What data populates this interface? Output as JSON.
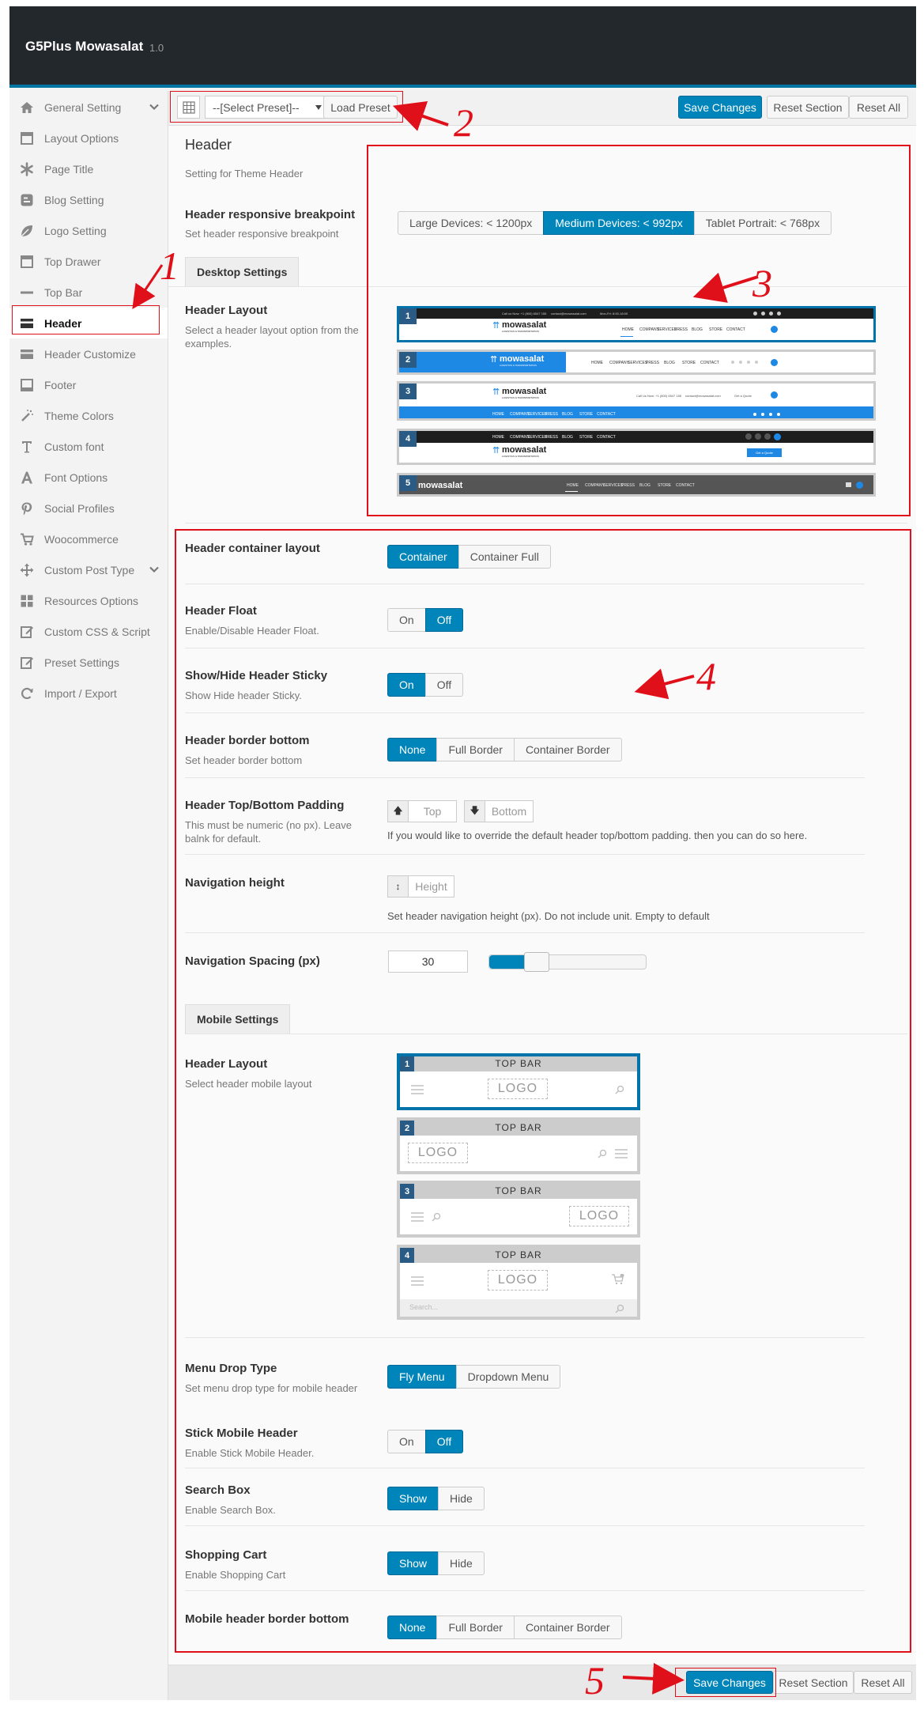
{
  "app": {
    "title": "G5Plus Mowasalat",
    "version": "1.0"
  },
  "sidebar": {
    "items": [
      {
        "label": "General Setting",
        "icon": "home-icon",
        "expandable": true
      },
      {
        "label": "Layout Options",
        "icon": "layout-icon"
      },
      {
        "label": "Page Title",
        "icon": "asterisk-icon"
      },
      {
        "label": "Blog Setting",
        "icon": "blogger-icon"
      },
      {
        "label": "Logo Setting",
        "icon": "leaf-icon"
      },
      {
        "label": "Top Drawer",
        "icon": "window-icon"
      },
      {
        "label": "Top Bar",
        "icon": "minus-icon"
      },
      {
        "label": "Header",
        "icon": "card-icon",
        "active": true
      },
      {
        "label": "Header Customize",
        "icon": "header-bars-icon"
      },
      {
        "label": "Footer",
        "icon": "footer-icon"
      },
      {
        "label": "Theme Colors",
        "icon": "magic-wand-icon"
      },
      {
        "label": "Custom font",
        "icon": "text-icon"
      },
      {
        "label": "Font Options",
        "icon": "font-icon"
      },
      {
        "label": "Social Profiles",
        "icon": "pinterest-icon"
      },
      {
        "label": "Woocommerce",
        "icon": "cart-icon"
      },
      {
        "label": "Custom Post Type",
        "icon": "move-icon",
        "expandable": true
      },
      {
        "label": "Resources Options",
        "icon": "grid-icon"
      },
      {
        "label": "Custom CSS & Script",
        "icon": "edit-icon"
      },
      {
        "label": "Preset Settings",
        "icon": "edit-icon"
      },
      {
        "label": "Import / Export",
        "icon": "refresh-icon"
      }
    ]
  },
  "toolbar": {
    "preset_placeholder": "--[Select Preset]--",
    "load_preset": "Load Preset",
    "save_changes": "Save Changes",
    "reset_section": "Reset Section",
    "reset_all": "Reset All"
  },
  "section": {
    "title": "Header",
    "subtitle": "Setting for Theme Header"
  },
  "breakpoint": {
    "title": "Header responsive breakpoint",
    "desc": "Set header responsive breakpoint",
    "options": [
      "Large Devices: < 1200px",
      "Medium Devices: < 992px",
      "Tablet Portrait: < 768px"
    ],
    "selected": 1
  },
  "desktop": {
    "tab": "Desktop Settings",
    "layout_title": "Header Layout",
    "layout_desc": [
      "Select a header layout option from the",
      "examples."
    ],
    "layouts": [
      {
        "num": "1",
        "logo": "mowasalat",
        "tagline": "LOGISTICS & TRANSPORTATION",
        "nav": [
          "HOME",
          "COMPANY",
          "SERVICES",
          "PRESS",
          "BLOG",
          "STORE",
          "CONTACT"
        ],
        "topbar_text": [
          "Call us Now: +1 (800) 6547 155",
          "contact@mowasalat.com",
          "Mon-Fri: 8:00-18:00"
        ]
      },
      {
        "num": "2",
        "logo": "mowasalat",
        "tagline": "LOGISTICS & TRANSPORTATION",
        "nav": [
          "HOME",
          "COMPANY",
          "SERVICES",
          "PRESS",
          "BLOG",
          "STORE",
          "CONTACT"
        ]
      },
      {
        "num": "3",
        "logo": "mowasalat",
        "tagline": "LOGISTICS & TRANSPORTATION",
        "nav": [
          "HOME",
          "COMPANY",
          "SERVICES",
          "PRESS",
          "BLOG",
          "STORE",
          "CONTACT"
        ],
        "contact": [
          "Call Us Now: +1 (800) 6547 155",
          "contact@mowasalat.com",
          "Get a Quote"
        ]
      },
      {
        "num": "4",
        "logo": "mowasalat",
        "tagline": "LOGISTICS & TRANSPORTATION",
        "nav": [
          "HOME",
          "COMPANY",
          "SERVICES",
          "PRESS",
          "BLOG",
          "STORE",
          "CONTACT"
        ],
        "cta": "Get a Quote"
      },
      {
        "num": "5",
        "logo": "mowasalat",
        "nav": [
          "HOME",
          "COMPANY",
          "SERVICES",
          "PRESS",
          "BLOG",
          "STORE",
          "CONTACT"
        ]
      }
    ],
    "selected_layout": 0
  },
  "container_layout": {
    "title": "Header container layout",
    "options": [
      "Container",
      "Container Full"
    ],
    "selected": 0
  },
  "header_float": {
    "title": "Header Float",
    "desc": "Enable/Disable Header Float.",
    "options": [
      "On",
      "Off"
    ],
    "selected": 1
  },
  "header_sticky": {
    "title": "Show/Hide Header Sticky",
    "desc": "Show Hide header Sticky.",
    "options": [
      "On",
      "Off"
    ],
    "selected": 0
  },
  "border_bottom": {
    "title": "Header border bottom",
    "desc": "Set header border bottom",
    "options": [
      "None",
      "Full Border",
      "Container Border"
    ],
    "selected": 0
  },
  "padding": {
    "title": "Header Top/Bottom Padding",
    "desc": [
      "This must be numeric (no px). Leave",
      "balnk for default."
    ],
    "top_placeholder": "Top",
    "bottom_placeholder": "Bottom",
    "hint": "If you would like to override the default header top/bottom padding. then you can do so here."
  },
  "nav_height": {
    "title": "Navigation height",
    "placeholder": "Height",
    "hint": "Set header navigation height (px). Do not include unit. Empty to default"
  },
  "nav_spacing": {
    "title": "Navigation Spacing (px)",
    "value": "30",
    "slider_fraction": 0.3
  },
  "mobile": {
    "tab": "Mobile Settings",
    "layout_title": "Header Layout",
    "layout_desc": "Select header mobile layout",
    "layouts": [
      {
        "num": "1",
        "top": "TOP  BAR",
        "logo": "LOGO"
      },
      {
        "num": "2",
        "top": "TOP  BAR",
        "logo": "LOGO"
      },
      {
        "num": "3",
        "top": "TOP  BAR",
        "logo": "LOGO"
      },
      {
        "num": "4",
        "top": "TOP  BAR",
        "logo": "LOGO",
        "search": "Search..."
      }
    ],
    "selected_layout": 0
  },
  "menu_drop": {
    "title": "Menu Drop Type",
    "desc": "Set menu drop type for mobile header",
    "options": [
      "Fly Menu",
      "Dropdown Menu"
    ],
    "selected": 0
  },
  "stick_mobile": {
    "title": "Stick Mobile Header",
    "desc": "Enable Stick Mobile Header.",
    "options": [
      "On",
      "Off"
    ],
    "selected": 1
  },
  "search_box": {
    "title": "Search Box",
    "desc": "Enable Search Box.",
    "options": [
      "Show",
      "Hide"
    ],
    "selected": 0
  },
  "shopping_cart": {
    "title": "Shopping Cart",
    "desc": "Enable Shopping Cart",
    "options": [
      "Show",
      "Hide"
    ],
    "selected": 0
  },
  "mobile_border": {
    "title": "Mobile header border bottom",
    "options": [
      "None",
      "Full Border",
      "Container Border"
    ],
    "selected": 0
  },
  "annotations": [
    "1",
    "2",
    "3",
    "4",
    "5"
  ],
  "colors": {
    "accent": "#0085ba",
    "annotation": "#e0101a",
    "topbar": "#23282d",
    "layout_blue": "#1e88e5"
  }
}
